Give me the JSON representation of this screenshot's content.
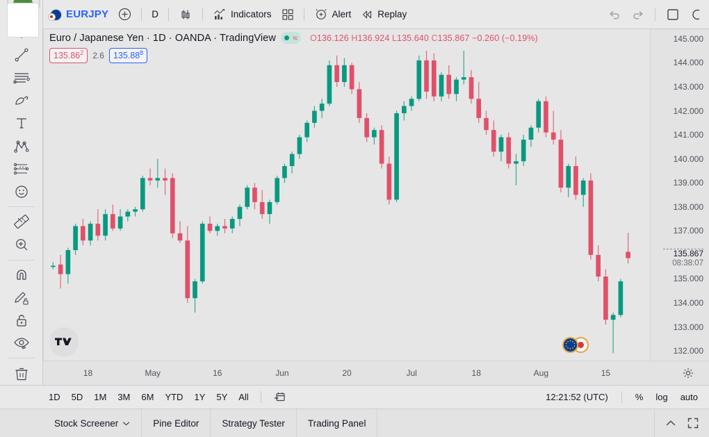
{
  "topbar": {
    "symbol": "EURJPY",
    "add_symbol_label": "+",
    "interval": "D",
    "chart_type_icon": "candles-icon",
    "indicators_label": "Indicators",
    "layout_icon": "layouts-icon",
    "alert_label": "Alert",
    "replay_label": "Replay",
    "undo_icon": "undo-icon",
    "redo_icon": "redo-icon",
    "fullscreen_icon": "square-icon"
  },
  "legend": {
    "title": "Euro / Japanese Yen · 1D · OANDA · TradingView",
    "status_icon": "data-status-icon",
    "approx_icon": "approx-icon",
    "ohlc": {
      "o_key": "O",
      "o": "136.126",
      "h_key": "H",
      "h": "136.924",
      "l_key": "L",
      "l": "135.640",
      "c_key": "C",
      "c": "135.867",
      "change": "−0.260 (−0.19%)"
    },
    "bid": "135.86",
    "bid_sup": "2",
    "spread": "2.6",
    "ask": "135.88",
    "ask_sup": "8"
  },
  "colors": {
    "up": "#089981",
    "down": "#e0506a",
    "accent": "#2962ff",
    "background": "#e6e6e6",
    "panel": "#e9e9e9"
  },
  "price_scale": {
    "labels": [
      "145.000",
      "144.000",
      "143.000",
      "142.000",
      "141.000",
      "140.000",
      "139.000",
      "138.000",
      "137.000",
      "135.000",
      "134.000",
      "133.000",
      "132.000"
    ],
    "current_price": "135.867",
    "current_time": "08:38:07"
  },
  "time_scale": {
    "labels": [
      "18",
      "May",
      "16",
      "Jun",
      "20",
      "Jul",
      "18",
      "Aug",
      "15"
    ],
    "settings_icon": "gear-icon"
  },
  "range_bar": {
    "ranges": [
      "1D",
      "5D",
      "1M",
      "3M",
      "6M",
      "YTD",
      "1Y",
      "5Y",
      "All"
    ],
    "calendar_icon": "goto-date-icon",
    "clock": "12:21:52 (UTC)",
    "percent_label": "%",
    "log_label": "log",
    "auto_label": "auto"
  },
  "bottom_tabs": {
    "tabs": [
      {
        "label": "Stock Screener",
        "caret": true
      },
      {
        "label": "Pine Editor",
        "caret": false
      },
      {
        "label": "Strategy Tester",
        "caret": false
      },
      {
        "label": "Trading Panel",
        "caret": false
      }
    ],
    "collapse_icon": "chevron-up-icon",
    "expand_icon": "fullscreen-icon"
  },
  "left_toolbar": {
    "tools": [
      {
        "name": "cross-cursor-icon",
        "active": true
      },
      {
        "name": "trend-line-icon",
        "active": false
      },
      {
        "name": "pitchfork-icon",
        "active": false
      },
      {
        "name": "brush-icon",
        "active": false
      },
      {
        "name": "text-icon",
        "active": false
      },
      {
        "name": "patterns-icon",
        "active": false
      },
      {
        "name": "prediction-icon",
        "active": false
      },
      {
        "name": "emoji-icon",
        "active": false
      },
      {
        "name": "measure-icon",
        "active": false
      },
      {
        "name": "zoom-in-icon",
        "active": false
      },
      {
        "name": "magnet-icon",
        "active": false
      },
      {
        "name": "stay-in-drawing-mode-icon",
        "active": false
      },
      {
        "name": "lock-drawings-icon",
        "active": false
      },
      {
        "name": "hide-drawings-icon",
        "active": false
      },
      {
        "name": "remove-drawings-icon",
        "active": false
      }
    ]
  },
  "chart_data": {
    "type": "candlestick",
    "title": "Euro / Japanese Yen · 1D · OANDA · TradingView",
    "xlabel": "",
    "ylabel": "",
    "ylim": [
      131.6,
      145.4
    ],
    "grid": false,
    "up_color": "#089981",
    "down_color": "#e0506a",
    "xticks": [
      "18",
      "May",
      "16",
      "Jun",
      "20",
      "Jul",
      "18",
      "Aug",
      "15"
    ],
    "yticks": [
      145.0,
      144.0,
      143.0,
      142.0,
      141.0,
      140.0,
      139.0,
      138.0,
      137.0,
      135.0,
      134.0,
      133.0,
      132.0
    ],
    "last_close": 135.867,
    "candles": [
      {
        "o": 135.5,
        "h": 135.7,
        "l": 135.4,
        "c": 135.55
      },
      {
        "o": 135.6,
        "h": 136.0,
        "l": 134.6,
        "c": 135.2
      },
      {
        "o": 135.2,
        "h": 136.3,
        "l": 134.8,
        "c": 136.2
      },
      {
        "o": 136.2,
        "h": 137.3,
        "l": 136.0,
        "c": 137.2
      },
      {
        "o": 137.2,
        "h": 137.5,
        "l": 136.4,
        "c": 136.6
      },
      {
        "o": 136.6,
        "h": 137.4,
        "l": 136.4,
        "c": 137.3
      },
      {
        "o": 137.3,
        "h": 137.9,
        "l": 136.6,
        "c": 136.8
      },
      {
        "o": 136.8,
        "h": 137.9,
        "l": 136.6,
        "c": 137.7
      },
      {
        "o": 137.7,
        "h": 138.1,
        "l": 137.0,
        "c": 137.1
      },
      {
        "o": 137.1,
        "h": 137.9,
        "l": 137.0,
        "c": 137.6
      },
      {
        "o": 137.6,
        "h": 137.9,
        "l": 137.4,
        "c": 137.8
      },
      {
        "o": 137.8,
        "h": 138.0,
        "l": 137.6,
        "c": 137.9
      },
      {
        "o": 137.9,
        "h": 139.3,
        "l": 137.8,
        "c": 139.2
      },
      {
        "o": 139.2,
        "h": 139.6,
        "l": 138.9,
        "c": 139.1
      },
      {
        "o": 139.1,
        "h": 140.0,
        "l": 138.8,
        "c": 139.2
      },
      {
        "o": 139.2,
        "h": 139.6,
        "l": 138.5,
        "c": 139.1
      },
      {
        "o": 139.2,
        "h": 139.4,
        "l": 136.7,
        "c": 136.9
      },
      {
        "o": 136.9,
        "h": 137.4,
        "l": 136.5,
        "c": 136.6
      },
      {
        "o": 136.6,
        "h": 137.2,
        "l": 134.0,
        "c": 134.2
      },
      {
        "o": 134.2,
        "h": 135.0,
        "l": 133.6,
        "c": 134.9
      },
      {
        "o": 134.9,
        "h": 137.4,
        "l": 134.8,
        "c": 137.3
      },
      {
        "o": 137.3,
        "h": 137.6,
        "l": 136.9,
        "c": 137.0
      },
      {
        "o": 137.0,
        "h": 137.3,
        "l": 136.8,
        "c": 137.2
      },
      {
        "o": 137.2,
        "h": 137.5,
        "l": 136.9,
        "c": 137.1
      },
      {
        "o": 137.1,
        "h": 137.6,
        "l": 136.9,
        "c": 137.5
      },
      {
        "o": 137.5,
        "h": 138.1,
        "l": 137.2,
        "c": 138.0
      },
      {
        "o": 138.0,
        "h": 138.9,
        "l": 137.9,
        "c": 138.8
      },
      {
        "o": 138.8,
        "h": 139.0,
        "l": 137.9,
        "c": 138.2
      },
      {
        "o": 138.2,
        "h": 138.7,
        "l": 137.5,
        "c": 137.7
      },
      {
        "o": 137.7,
        "h": 138.3,
        "l": 137.3,
        "c": 138.2
      },
      {
        "o": 138.2,
        "h": 139.3,
        "l": 138.1,
        "c": 139.2
      },
      {
        "o": 139.2,
        "h": 139.8,
        "l": 139.0,
        "c": 139.7
      },
      {
        "o": 139.7,
        "h": 140.3,
        "l": 139.4,
        "c": 140.2
      },
      {
        "o": 140.2,
        "h": 141.0,
        "l": 140.0,
        "c": 140.9
      },
      {
        "o": 140.9,
        "h": 141.6,
        "l": 140.7,
        "c": 141.5
      },
      {
        "o": 141.5,
        "h": 142.2,
        "l": 141.3,
        "c": 142.0
      },
      {
        "o": 142.0,
        "h": 142.5,
        "l": 141.7,
        "c": 142.3
      },
      {
        "o": 142.3,
        "h": 144.1,
        "l": 142.2,
        "c": 143.9
      },
      {
        "o": 143.9,
        "h": 144.3,
        "l": 143.0,
        "c": 143.2
      },
      {
        "o": 143.2,
        "h": 144.2,
        "l": 143.0,
        "c": 143.9
      },
      {
        "o": 143.9,
        "h": 144.0,
        "l": 142.7,
        "c": 142.9
      },
      {
        "o": 142.9,
        "h": 143.2,
        "l": 141.5,
        "c": 141.7
      },
      {
        "o": 141.7,
        "h": 141.9,
        "l": 140.7,
        "c": 140.9
      },
      {
        "o": 140.9,
        "h": 141.3,
        "l": 140.6,
        "c": 141.2
      },
      {
        "o": 141.2,
        "h": 141.4,
        "l": 139.6,
        "c": 139.8
      },
      {
        "o": 139.8,
        "h": 140.1,
        "l": 138.1,
        "c": 138.3
      },
      {
        "o": 138.3,
        "h": 142.0,
        "l": 138.2,
        "c": 141.9
      },
      {
        "o": 141.9,
        "h": 142.4,
        "l": 141.6,
        "c": 142.2
      },
      {
        "o": 142.2,
        "h": 142.6,
        "l": 142.0,
        "c": 142.5
      },
      {
        "o": 142.5,
        "h": 144.3,
        "l": 142.4,
        "c": 144.1
      },
      {
        "o": 144.1,
        "h": 144.5,
        "l": 142.5,
        "c": 142.8
      },
      {
        "o": 144.1,
        "h": 144.4,
        "l": 142.4,
        "c": 142.6
      },
      {
        "o": 142.6,
        "h": 143.6,
        "l": 142.4,
        "c": 143.5
      },
      {
        "o": 143.5,
        "h": 143.9,
        "l": 142.5,
        "c": 142.7
      },
      {
        "o": 142.7,
        "h": 143.4,
        "l": 142.4,
        "c": 143.3
      },
      {
        "o": 143.3,
        "h": 144.5,
        "l": 143.1,
        "c": 143.4
      },
      {
        "o": 143.4,
        "h": 143.7,
        "l": 142.3,
        "c": 142.5
      },
      {
        "o": 142.5,
        "h": 143.2,
        "l": 141.5,
        "c": 141.7
      },
      {
        "o": 141.7,
        "h": 142.0,
        "l": 141.0,
        "c": 141.2
      },
      {
        "o": 141.2,
        "h": 141.6,
        "l": 140.1,
        "c": 140.3
      },
      {
        "o": 140.3,
        "h": 141.0,
        "l": 139.9,
        "c": 140.9
      },
      {
        "o": 140.9,
        "h": 141.1,
        "l": 139.6,
        "c": 139.8
      },
      {
        "o": 139.8,
        "h": 140.2,
        "l": 138.9,
        "c": 139.9
      },
      {
        "o": 139.9,
        "h": 141.0,
        "l": 139.7,
        "c": 140.8
      },
      {
        "o": 140.8,
        "h": 141.4,
        "l": 140.5,
        "c": 141.3
      },
      {
        "o": 141.3,
        "h": 142.5,
        "l": 141.1,
        "c": 142.4
      },
      {
        "o": 142.4,
        "h": 142.6,
        "l": 140.9,
        "c": 141.1
      },
      {
        "o": 141.1,
        "h": 142.0,
        "l": 140.6,
        "c": 140.8
      },
      {
        "o": 140.8,
        "h": 141.2,
        "l": 138.6,
        "c": 138.8
      },
      {
        "o": 138.8,
        "h": 139.8,
        "l": 138.4,
        "c": 139.7
      },
      {
        "o": 139.7,
        "h": 140.1,
        "l": 138.3,
        "c": 138.5
      },
      {
        "o": 138.5,
        "h": 139.2,
        "l": 138.0,
        "c": 139.1
      },
      {
        "o": 139.1,
        "h": 139.4,
        "l": 135.8,
        "c": 136.0
      },
      {
        "o": 136.0,
        "h": 136.4,
        "l": 134.9,
        "c": 135.1
      },
      {
        "o": 135.1,
        "h": 135.4,
        "l": 133.1,
        "c": 133.3
      },
      {
        "o": 133.3,
        "h": 133.6,
        "l": 131.9,
        "c": 133.5
      },
      {
        "o": 133.5,
        "h": 135.0,
        "l": 133.4,
        "c": 134.9
      },
      {
        "o": 136.126,
        "h": 136.924,
        "l": 135.64,
        "c": 135.867
      }
    ]
  }
}
